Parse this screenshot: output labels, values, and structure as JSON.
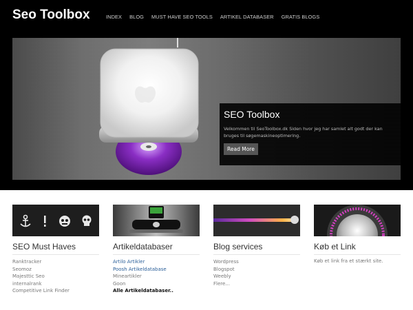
{
  "site": {
    "logo": "Seo Toolbox",
    "nav": [
      "INDEX",
      "BLOG",
      "MUST HAVE SEO TOOLS",
      "ARTIKEL DATABASER",
      "GRATIS BLOGS"
    ]
  },
  "slider": {
    "title": "SEO Toolbox",
    "text": "Velkommen til SeoToolbox.dk Siden hvor jeg har samlet alt godt der kan bruges til søgemaskineoptimering.",
    "button": "Read More"
  },
  "columns": [
    {
      "title": "SEO Must Haves",
      "items": [
        "Ranktracker",
        "Seomoz",
        "Majesttic Seo",
        "internalrank",
        "Competitive Link Finder"
      ]
    },
    {
      "title": "Artikeldatabaser",
      "items": [
        "Artilo Artikler",
        "Poosh Artikeldatabase",
        "Mineartikler",
        "Goon",
        "Alle Artikeldatabaser.."
      ]
    },
    {
      "title": "Blog services",
      "items": [
        "Wordpress",
        "Blogspot",
        "Weebly",
        "Flere..."
      ]
    },
    {
      "title": "Køb et Link",
      "text": "Køb et link fra et stærkt site."
    }
  ],
  "colors": {
    "header_bg": "#000000",
    "link": "#2b5f99",
    "purple_disc": "#8a2ec4"
  }
}
